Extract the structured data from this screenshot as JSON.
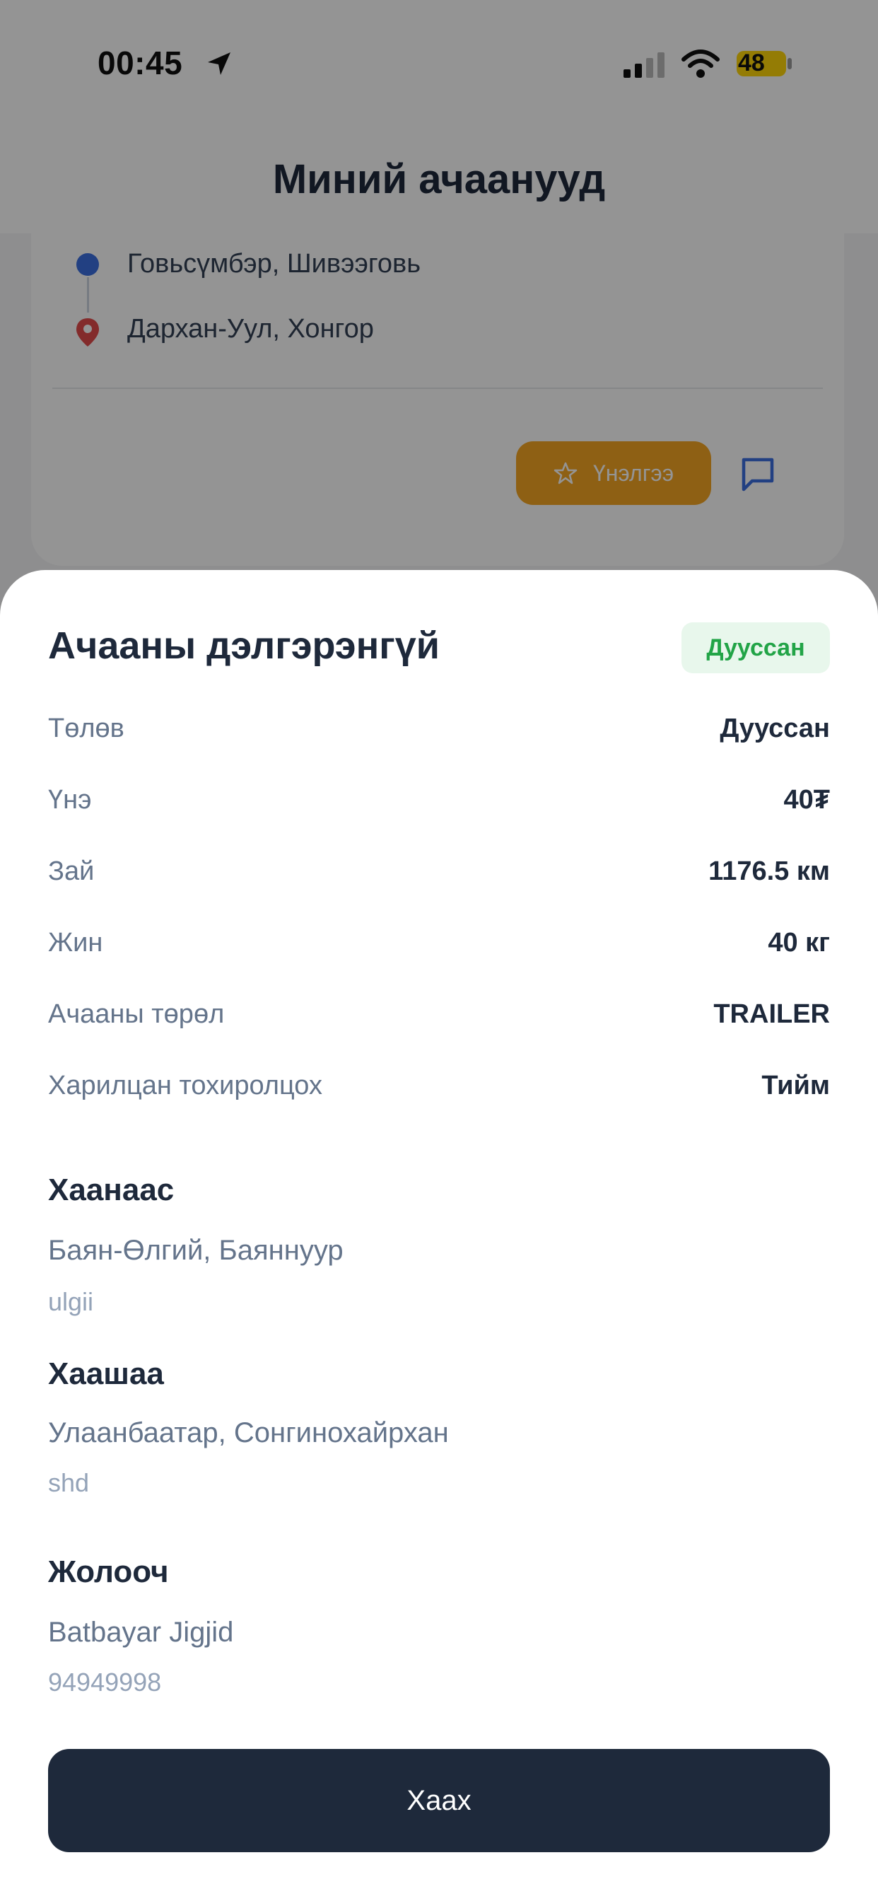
{
  "status_bar": {
    "time": "00:45",
    "battery": "48"
  },
  "header": {
    "title": "Миний ачаанууд"
  },
  "card": {
    "origin": "Говьсүмбэр, Шивээговь",
    "destination": "Дархан-Уул, Хонгор",
    "rate_label": "Үнэлгээ"
  },
  "sheet": {
    "title": "Ачааны дэлгэрэнгүй",
    "status_badge": "Дууссан",
    "details": [
      {
        "label": "Төлөв",
        "value": "Дууссан"
      },
      {
        "label": "Үнэ",
        "value": "40₮"
      },
      {
        "label": "Зай",
        "value": "1176.5 км"
      },
      {
        "label": "Жин",
        "value": "40 кг"
      },
      {
        "label": "Ачааны төрөл",
        "value": "TRAILER"
      },
      {
        "label": "Харилцан тохиролцох",
        "value": "Тийм"
      }
    ],
    "from": {
      "title": "Хаанаас",
      "location": "Баян-Өлгий, Баяннуур",
      "note": "ulgii"
    },
    "to": {
      "title": "Хаашаа",
      "location": "Улаанбаатар, Сонгинохайрхан",
      "note": "shd"
    },
    "driver": {
      "title": "Жолооч",
      "name": "Batbayar Jigjid",
      "phone": "94949998"
    },
    "close_label": "Хаах"
  },
  "colors": {
    "primary_dark": "#1e293b",
    "badge_green": "#22a447",
    "rate_orange": "#f5a524",
    "origin_blue": "#3b6fe0",
    "destination_red": "#e24b4b"
  }
}
